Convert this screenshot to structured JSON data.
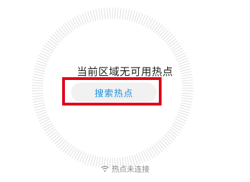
{
  "hotspot_panel": {
    "message": "当前区域无可用热点",
    "search_button_label": "搜索热点",
    "status_text": "热点未连接",
    "status_icon": "wifi-icon"
  },
  "colors": {
    "accent_blue": "#1d8fe0",
    "highlight_red": "#e0001a",
    "button_bg": "#f1f1f1",
    "tick_color": "#d8d8d8",
    "status_gray": "#8c8c8c"
  }
}
